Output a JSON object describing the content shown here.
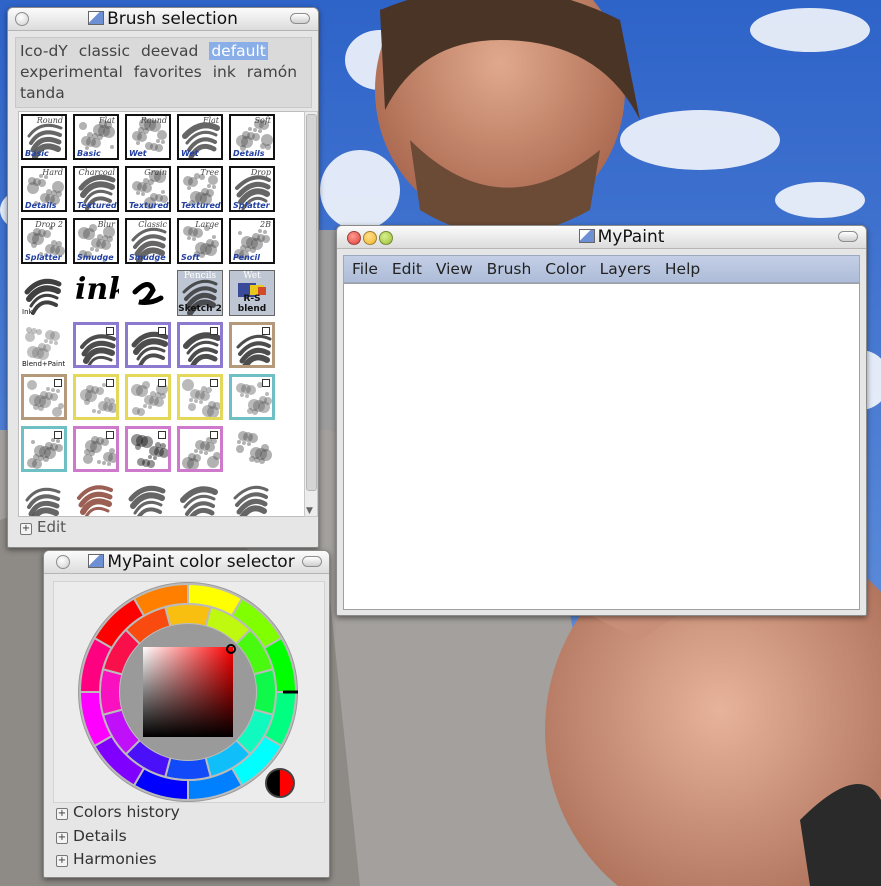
{
  "brush_window": {
    "title": "Brush selection",
    "groups": [
      "Ico-dY",
      "classic",
      "deevad",
      "default",
      "experimental",
      "favorites",
      "ink",
      "ramón",
      "tanda"
    ],
    "selected_group": "default",
    "edit_label": "Edit",
    "brushes": [
      {
        "name": "Round",
        "cat": "Basic"
      },
      {
        "name": "Flat",
        "cat": "Basic"
      },
      {
        "name": "Round",
        "cat": "Wet"
      },
      {
        "name": "Flat",
        "cat": "Wet"
      },
      {
        "name": "Soft",
        "cat": "Details"
      },
      {
        "name": "Hard",
        "cat": "Details"
      },
      {
        "name": "Charcoal",
        "cat": "Textured"
      },
      {
        "name": "Grain",
        "cat": "Textured"
      },
      {
        "name": "Tree",
        "cat": "Textured"
      },
      {
        "name": "Drop",
        "cat": "Splatter"
      },
      {
        "name": "Drop 2",
        "cat": "Splatter"
      },
      {
        "name": "Blur",
        "cat": "Smudge"
      },
      {
        "name": "Classic",
        "cat": "Smudge"
      },
      {
        "name": "Large",
        "cat": "Soft"
      },
      {
        "name": "2B",
        "cat": "Pencil"
      }
    ],
    "special_brushes": {
      "ink_caption": "Ink",
      "ink_word": "ink",
      "pencils_top": "Pencils",
      "pencils_caption": "Sketch 2",
      "wet_top": "Wet",
      "wet_caption": "R-S blend",
      "blend_caption": "Blend+Paint"
    }
  },
  "color_window": {
    "title": "MyPaint color selector",
    "sections": [
      "Colors history",
      "Details",
      "Harmonies"
    ],
    "current_color": "#ff0000",
    "previous_color": "#000000"
  },
  "main_window": {
    "title": "MyPaint",
    "menu": [
      "File",
      "Edit",
      "View",
      "Brush",
      "Color",
      "Layers",
      "Help"
    ]
  },
  "colors": {
    "selection_highlight": "#89aee8",
    "menubar": "#b8c5df",
    "close_red": "#e2413b",
    "min_yellow": "#f2b42c",
    "max_green": "#9bbf3a"
  },
  "icons": [
    "window-app-icon",
    "expander-plus-icon",
    "close-circle-icon",
    "shade-pill-icon"
  ]
}
